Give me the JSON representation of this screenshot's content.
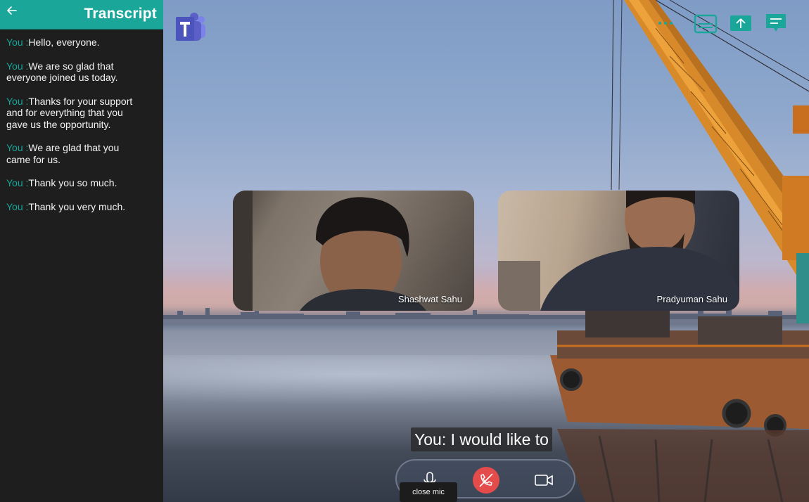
{
  "sidebar": {
    "title": "Transcript",
    "back_icon": "arrow-left-icon",
    "entries": [
      {
        "speaker": "You :",
        "text": "Hello, everyone."
      },
      {
        "speaker": "You :",
        "text": "We are so glad that everyone joined us today."
      },
      {
        "speaker": "You :",
        "text": "Thanks for your support and for everything that you gave us the opportunity."
      },
      {
        "speaker": "You :",
        "text": "We are glad that you came for us."
      },
      {
        "speaker": "You :",
        "text": "Thank you so much."
      },
      {
        "speaker": "You :",
        "text": "Thank you very much."
      }
    ]
  },
  "participants": [
    {
      "name": "Shashwat Sahu"
    },
    {
      "name": "Pradyuman Sahu"
    }
  ],
  "caption": {
    "text": "You: I would like to"
  },
  "controls": {
    "mic_tooltip": "close mic",
    "icons": [
      "microphone-icon",
      "hang-up-icon",
      "camera-icon"
    ]
  },
  "top_actions": {
    "icons": [
      "more-icon",
      "captions-icon",
      "share-screen-icon",
      "chat-icon"
    ]
  },
  "colors": {
    "accent": "#1aa79a",
    "hangup": "#e44b4b",
    "teams_purple": "#5b5fc7"
  }
}
